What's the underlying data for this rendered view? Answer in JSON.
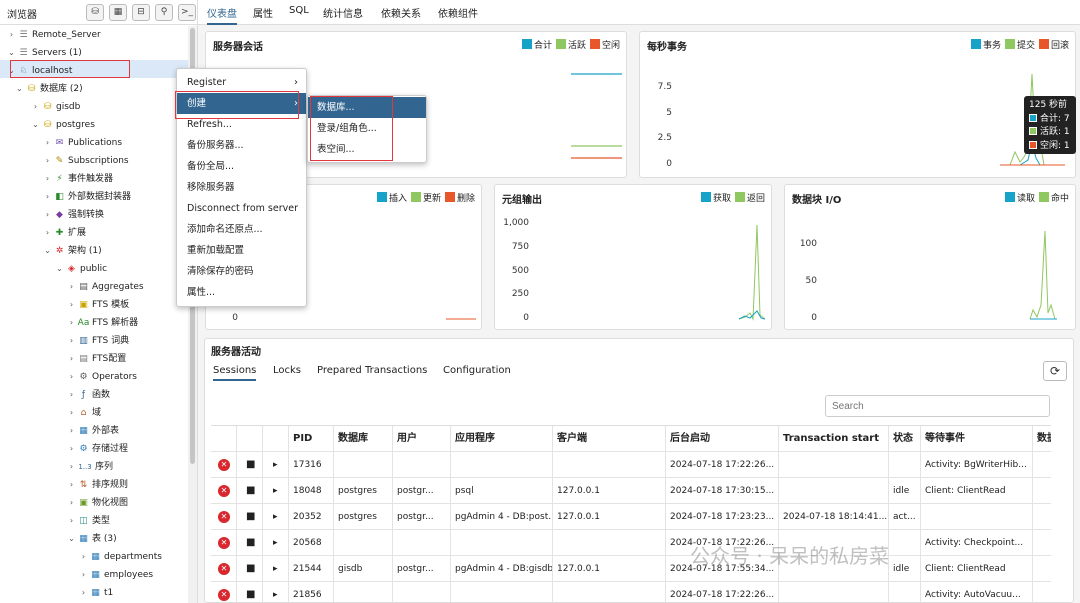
{
  "sidebar": {
    "title": "浏览器",
    "toolbar": [
      {
        "icon": "database-icon",
        "glyph": "⛁"
      },
      {
        "icon": "table-icon",
        "glyph": "▦"
      },
      {
        "icon": "filter-icon",
        "glyph": "⊟"
      },
      {
        "icon": "search-icon",
        "glyph": "⚲"
      },
      {
        "icon": "terminal-icon",
        "glyph": ">_"
      }
    ],
    "tree": [
      {
        "label": "Remote_Server",
        "depth": 0,
        "arrow": "›",
        "icon": "server-icon",
        "glyph": "☰",
        "color": "#777"
      },
      {
        "label": "Servers (1)",
        "depth": 0,
        "arrow": "⌄",
        "icon": "servers-icon",
        "glyph": "☰",
        "color": "#777"
      },
      {
        "label": "localhost",
        "depth": 1,
        "arrow": "⌄",
        "icon": "elephant-icon",
        "glyph": "♘",
        "color": "#336791"
      },
      {
        "label": "数据库 (2)",
        "depth": 2,
        "arrow": "⌄",
        "icon": "databases-icon",
        "glyph": "⛁",
        "color": "#c9a100"
      },
      {
        "label": "gisdb",
        "depth": 3,
        "arrow": "›",
        "icon": "database-icon",
        "glyph": "⛁",
        "color": "#c9a100"
      },
      {
        "label": "postgres",
        "depth": 3,
        "arrow": "⌄",
        "icon": "database-icon",
        "glyph": "⛁",
        "color": "#c9a100"
      },
      {
        "label": "Publications",
        "depth": 4,
        "arrow": "›",
        "icon": "publication-icon",
        "glyph": "✉",
        "color": "#6a4cae"
      },
      {
        "label": "Subscriptions",
        "depth": 4,
        "arrow": "›",
        "icon": "subscription-icon",
        "glyph": "✎",
        "color": "#b08000"
      },
      {
        "label": "事件触发器",
        "depth": 4,
        "arrow": "›",
        "icon": "event-trigger-icon",
        "glyph": "⚡",
        "color": "#2a8a2a"
      },
      {
        "label": "外部数据封装器",
        "depth": 4,
        "arrow": "›",
        "icon": "fdw-icon",
        "glyph": "◧",
        "color": "#2a8a2a"
      },
      {
        "label": "强制转换",
        "depth": 4,
        "arrow": "›",
        "icon": "cast-icon",
        "glyph": "◆",
        "color": "#7a3aa5"
      },
      {
        "label": "扩展",
        "depth": 4,
        "arrow": "›",
        "icon": "extension-icon",
        "glyph": "✚",
        "color": "#2a8a2a"
      },
      {
        "label": "架构 (1)",
        "depth": 4,
        "arrow": "⌄",
        "icon": "schemas-icon",
        "glyph": "✲",
        "color": "#d9272e"
      },
      {
        "label": "public",
        "depth": 5,
        "arrow": "⌄",
        "icon": "schema-icon",
        "glyph": "◈",
        "color": "#d9272e"
      },
      {
        "label": "Aggregates",
        "depth": 6,
        "arrow": "›",
        "icon": "aggregate-icon",
        "glyph": "▤",
        "color": "#555"
      },
      {
        "label": "FTS 模板",
        "depth": 6,
        "arrow": "›",
        "icon": "fts-template-icon",
        "glyph": "▣",
        "color": "#c9a100"
      },
      {
        "label": "FTS 解析器",
        "depth": 6,
        "arrow": "›",
        "icon": "fts-parser-icon",
        "glyph": "Aa",
        "color": "#2a8a2a"
      },
      {
        "label": "FTS 词典",
        "depth": 6,
        "arrow": "›",
        "icon": "fts-dictionary-icon",
        "glyph": "▥",
        "color": "#336791"
      },
      {
        "label": "FTS配置",
        "depth": 6,
        "arrow": "›",
        "icon": "fts-config-icon",
        "glyph": "▤",
        "color": "#777"
      },
      {
        "label": "Operators",
        "depth": 6,
        "arrow": "›",
        "icon": "operator-icon",
        "glyph": "⚙",
        "color": "#555"
      },
      {
        "label": "函数",
        "depth": 6,
        "arrow": "›",
        "icon": "function-icon",
        "glyph": "ƒ",
        "color": "#336791"
      },
      {
        "label": "域",
        "depth": 6,
        "arrow": "›",
        "icon": "domain-icon",
        "glyph": "⌂",
        "color": "#b05a2a"
      },
      {
        "label": "外部表",
        "depth": 6,
        "arrow": "›",
        "icon": "foreign-table-icon",
        "glyph": "▦",
        "color": "#2a7ab5"
      },
      {
        "label": "存储过程",
        "depth": 6,
        "arrow": "›",
        "icon": "procedure-icon",
        "glyph": "⚙",
        "color": "#2a7ab5"
      },
      {
        "label": "序列",
        "depth": 6,
        "arrow": "›",
        "icon": "sequence-icon",
        "glyph": "1..3",
        "color": "#336791"
      },
      {
        "label": "排序规则",
        "depth": 6,
        "arrow": "›",
        "icon": "collation-icon",
        "glyph": "⇅",
        "color": "#b05a2a"
      },
      {
        "label": "物化视图",
        "depth": 6,
        "arrow": "›",
        "icon": "mview-icon",
        "glyph": "▣",
        "color": "#6a9a2a"
      },
      {
        "label": "类型",
        "depth": 6,
        "arrow": "›",
        "icon": "type-icon",
        "glyph": "◫",
        "color": "#2a8a8a"
      },
      {
        "label": "表 (3)",
        "depth": 6,
        "arrow": "⌄",
        "icon": "tables-icon",
        "glyph": "▦",
        "color": "#2a7ab5"
      },
      {
        "label": "departments",
        "depth": 7,
        "arrow": "›",
        "icon": "table-icon",
        "glyph": "▦",
        "color": "#2a7ab5"
      },
      {
        "label": "employees",
        "depth": 7,
        "arrow": "›",
        "icon": "table-icon",
        "glyph": "▦",
        "color": "#2a7ab5"
      },
      {
        "label": "t1",
        "depth": 7,
        "arrow": "›",
        "icon": "table-icon",
        "glyph": "▦",
        "color": "#2a7ab5"
      }
    ]
  },
  "tabs": [
    "仪表盘",
    "属性",
    "SQL",
    "统计信息",
    "依赖关系",
    "依赖组件"
  ],
  "context_menu": {
    "items": [
      "Register",
      "创建",
      "Refresh...",
      "备份服务器...",
      "备份全局...",
      "移除服务器",
      "Disconnect from server",
      "添加命名还原点...",
      "重新加载配置",
      "清除保存的密码",
      "属性..."
    ],
    "submenu": [
      "数据库...",
      "登录/组角色...",
      "表空间..."
    ]
  },
  "charts": {
    "sessions": {
      "title": "服务器会话",
      "legend": [
        {
          "name": "合计",
          "color": "#17a2c8"
        },
        {
          "name": "活跃",
          "color": "#8fc760"
        },
        {
          "name": "空闲",
          "color": "#e8572a"
        }
      ]
    },
    "tps": {
      "title": "每秒事务",
      "legend": [
        {
          "name": "事务",
          "color": "#17a2c8"
        },
        {
          "name": "提交",
          "color": "#8fc760"
        },
        {
          "name": "回滚",
          "color": "#e8572a"
        }
      ],
      "yticks": [
        "7.5",
        "5",
        "2.5",
        "0"
      ]
    },
    "tuples_in": {
      "title": "",
      "legend": [
        {
          "name": "插入",
          "color": "#17a2c8"
        },
        {
          "name": "更新",
          "color": "#8fc760"
        },
        {
          "name": "删除",
          "color": "#e8572a"
        }
      ],
      "yticks": [
        "0"
      ]
    },
    "tuples_out": {
      "title": "元组输出",
      "legend": [
        {
          "name": "获取",
          "color": "#17a2c8"
        },
        {
          "name": "返回",
          "color": "#8fc760"
        }
      ],
      "yticks": [
        "1,000",
        "750",
        "500",
        "250",
        "0"
      ]
    },
    "block_io": {
      "title": "数据块 I/O",
      "legend": [
        {
          "name": "读取",
          "color": "#17a2c8"
        },
        {
          "name": "命中",
          "color": "#8fc760"
        }
      ],
      "yticks": [
        "100",
        "50",
        "0"
      ]
    }
  },
  "tooltip": {
    "title": "125 秒前",
    "rows": [
      {
        "label": "合计: 7",
        "color": "#17a2c8"
      },
      {
        "label": "活跃: 1",
        "color": "#8fc760"
      },
      {
        "label": "空闲: 1",
        "color": "#e8572a"
      }
    ]
  },
  "activity": {
    "title": "服务器活动",
    "tabs": [
      "Sessions",
      "Locks",
      "Prepared Transactions",
      "Configuration"
    ],
    "search_placeholder": "Search",
    "columns": [
      "PID",
      "数据库",
      "用户",
      "应用程序",
      "客户端",
      "后台启动",
      "Transaction start",
      "状态",
      "等待事件",
      "数据"
    ],
    "rows": [
      [
        "17316",
        "",
        "",
        "",
        "",
        "2024-07-18 17:22:26...",
        "",
        "",
        "Activity: BgWriterHib..."
      ],
      [
        "18048",
        "postgres",
        "postgr...",
        "psql",
        "127.0.0.1",
        "2024-07-18 17:30:15...",
        "",
        "idle",
        "Client: ClientRead"
      ],
      [
        "20352",
        "postgres",
        "postgr...",
        "pgAdmin 4 - DB:post...",
        "127.0.0.1",
        "2024-07-18 17:23:23...",
        "2024-07-18 18:14:41...",
        "act...",
        ""
      ],
      [
        "20568",
        "",
        "",
        "",
        "",
        "2024-07-18 17:22:26...",
        "",
        "",
        "Activity: Checkpoint..."
      ],
      [
        "21544",
        "gisdb",
        "postgr...",
        "pgAdmin 4 - DB:gisdb",
        "127.0.0.1",
        "2024-07-18 17:55:34...",
        "",
        "idle",
        "Client: ClientRead"
      ],
      [
        "21856",
        "",
        "",
        "",
        "",
        "2024-07-18 17:22:26...",
        "",
        "",
        "Activity: AutoVacuu..."
      ]
    ]
  },
  "watermark": "公众号 · 呆呆的私房菜"
}
